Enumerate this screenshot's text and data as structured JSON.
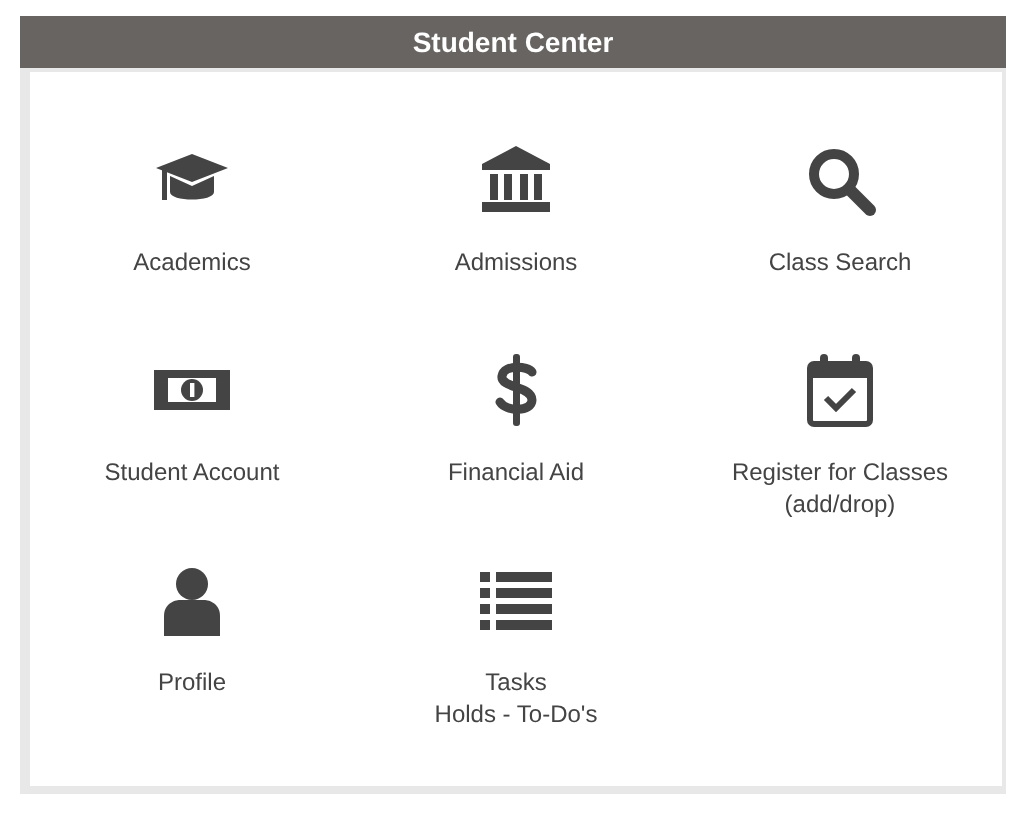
{
  "header": {
    "title": "Student Center"
  },
  "tiles": [
    {
      "kind": "cap",
      "lines": [
        "Academics"
      ]
    },
    {
      "kind": "bank",
      "lines": [
        "Admissions"
      ]
    },
    {
      "kind": "search",
      "lines": [
        "Class Search"
      ]
    },
    {
      "kind": "money",
      "lines": [
        "Student Account"
      ]
    },
    {
      "kind": "dollar",
      "lines": [
        "Financial Aid"
      ]
    },
    {
      "kind": "calendar",
      "lines": [
        "Register for Classes",
        "(add/drop)"
      ]
    },
    {
      "kind": "user",
      "lines": [
        "Profile"
      ]
    },
    {
      "kind": "list",
      "lines": [
        "Tasks",
        "Holds - To-Do's"
      ]
    }
  ]
}
